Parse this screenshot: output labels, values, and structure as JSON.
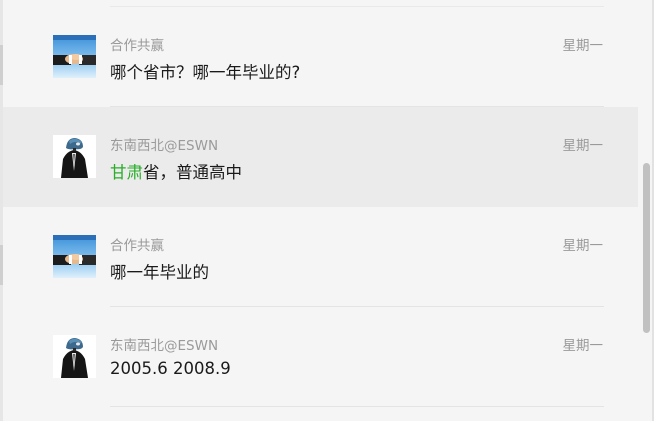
{
  "messages": [
    {
      "sender": "合作共赢",
      "time": "星期一",
      "content": "哪个省市？哪一年毕业的?",
      "avatar": "handshake-avatar",
      "active": false
    },
    {
      "sender": "东南西北@ESWN",
      "time": "星期一",
      "content_highlight": "甘肃",
      "content_rest": "省，普通高中",
      "avatar": "suit-person-avatar",
      "active": true
    },
    {
      "sender": "合作共赢",
      "time": "星期一",
      "content": "哪一年毕业的",
      "avatar": "handshake-avatar",
      "active": false
    },
    {
      "sender": "东南西北@ESWN",
      "time": "星期一",
      "content": "2005.6 2008.9",
      "avatar": "suit-person-avatar",
      "active": false
    }
  ],
  "colors": {
    "highlight": "#2aae2a",
    "active_bg": "#ebebeb",
    "panel_bg": "#f5f5f5",
    "meta_text": "#9a9a9a"
  }
}
